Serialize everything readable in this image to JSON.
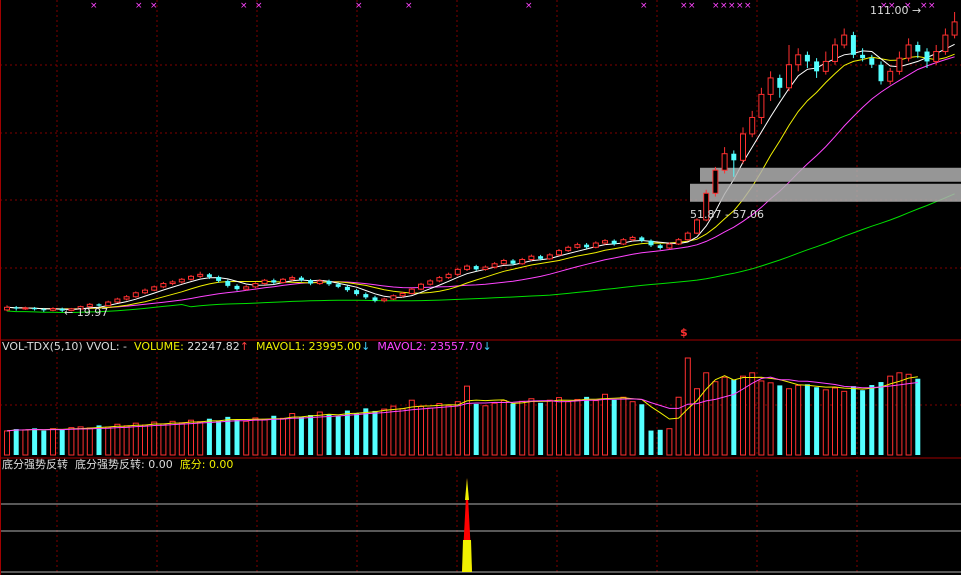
{
  "main_chart": {
    "high_label": "111.00",
    "low_label": "19.97",
    "range_label": "51.87 - 57.06",
    "signal_marker": "$"
  },
  "volume_panel": {
    "name": "VOL-TDX(5,10)",
    "vvol": "VVOL: -",
    "volume_label": "VOLUME:",
    "volume_value": "22247.82",
    "volume_arrow": "↑",
    "mavol1_label": "MAVOL1:",
    "mavol1_value": "23995.00",
    "mavol1_arrow": "↓",
    "mavol2_label": "MAVOL2:",
    "mavol2_value": "23557.70",
    "mavol2_arrow": "↓"
  },
  "indicator_panel": {
    "name": "底分强势反转",
    "signal_label": "底分强势反转:",
    "signal_value": "0.00",
    "dif_label": "底分:",
    "dif_value": "0.00"
  },
  "colors": {
    "background": "#000000",
    "up": "#ff3030",
    "down": "#54ffff",
    "ma_fast": "#ffffff",
    "ma_yellow": "#f0f000",
    "ma_magenta": "#ff44ff",
    "ma_green": "#00e000",
    "grid": "#800000"
  },
  "chart_data": {
    "type": "candlestick",
    "price_range": [
      19.97,
      111.0
    ],
    "candles": [
      [
        20.6,
        21.4,
        22.0,
        20.2
      ],
      [
        21.4,
        21.0,
        21.8,
        20.4
      ],
      [
        21.0,
        21.2,
        21.6,
        20.6
      ],
      [
        21.2,
        20.8,
        21.5,
        20.4
      ],
      [
        20.8,
        20.5,
        21.2,
        20.0
      ],
      [
        20.5,
        21.0,
        21.4,
        20.2
      ],
      [
        21.0,
        20.4,
        21.3,
        19.97
      ],
      [
        20.4,
        20.9,
        21.2,
        20.2
      ],
      [
        20.9,
        21.6,
        21.9,
        20.7
      ],
      [
        21.6,
        22.3,
        22.7,
        21.3
      ],
      [
        22.3,
        21.9,
        22.6,
        21.6
      ],
      [
        21.9,
        23.0,
        23.4,
        21.7
      ],
      [
        23.0,
        23.9,
        24.3,
        22.7
      ],
      [
        23.9,
        24.6,
        25.1,
        23.5
      ],
      [
        24.6,
        25.8,
        26.2,
        24.3
      ],
      [
        25.8,
        26.6,
        27.1,
        25.4
      ],
      [
        26.6,
        27.6,
        28.0,
        26.3
      ],
      [
        27.6,
        28.6,
        29.1,
        27.2
      ],
      [
        28.6,
        29.1,
        29.6,
        28.1
      ],
      [
        29.1,
        29.9,
        30.3,
        28.6
      ],
      [
        29.9,
        30.8,
        31.2,
        29.5
      ],
      [
        30.8,
        31.4,
        32.2,
        30.3
      ],
      [
        31.4,
        30.6,
        31.8,
        30.0
      ],
      [
        30.6,
        29.4,
        31.0,
        28.9
      ],
      [
        29.4,
        27.9,
        29.8,
        27.4
      ],
      [
        27.9,
        26.9,
        28.4,
        26.4
      ],
      [
        26.9,
        27.6,
        28.1,
        26.5
      ],
      [
        27.6,
        28.6,
        29.0,
        27.2
      ],
      [
        28.6,
        29.6,
        30.0,
        28.2
      ],
      [
        29.6,
        28.9,
        30.1,
        28.4
      ],
      [
        28.9,
        29.9,
        30.3,
        28.6
      ],
      [
        29.9,
        30.4,
        31.0,
        29.4
      ],
      [
        30.4,
        29.6,
        30.9,
        29.2
      ],
      [
        29.6,
        28.6,
        30.0,
        28.1
      ],
      [
        28.6,
        29.4,
        29.9,
        28.2
      ],
      [
        29.4,
        28.4,
        29.8,
        27.9
      ],
      [
        28.4,
        27.6,
        28.9,
        27.2
      ],
      [
        27.6,
        26.6,
        28.0,
        26.1
      ],
      [
        26.6,
        25.4,
        27.0,
        24.9
      ],
      [
        25.4,
        24.4,
        25.9,
        23.9
      ],
      [
        24.4,
        23.4,
        24.9,
        22.9
      ],
      [
        23.4,
        23.9,
        24.3,
        22.9
      ],
      [
        23.9,
        24.9,
        25.3,
        23.6
      ],
      [
        24.9,
        25.6,
        26.1,
        24.4
      ],
      [
        25.6,
        26.9,
        27.3,
        25.3
      ],
      [
        26.9,
        28.4,
        28.8,
        26.6
      ],
      [
        28.4,
        29.4,
        29.9,
        28.0
      ],
      [
        29.4,
        30.4,
        30.9,
        29.0
      ],
      [
        30.4,
        31.4,
        31.9,
        30.0
      ],
      [
        31.4,
        32.9,
        33.4,
        31.0
      ],
      [
        32.9,
        33.9,
        34.4,
        32.4
      ],
      [
        33.9,
        32.9,
        34.3,
        32.4
      ],
      [
        32.9,
        33.6,
        34.1,
        32.5
      ],
      [
        33.6,
        34.6,
        35.1,
        33.2
      ],
      [
        34.6,
        35.6,
        36.1,
        34.2
      ],
      [
        35.6,
        34.6,
        36.0,
        34.1
      ],
      [
        34.6,
        35.9,
        36.4,
        34.3
      ],
      [
        35.9,
        36.9,
        37.4,
        35.5
      ],
      [
        36.9,
        36.1,
        37.3,
        35.6
      ],
      [
        36.1,
        37.3,
        37.8,
        35.8
      ],
      [
        37.3,
        38.6,
        39.1,
        37.0
      ],
      [
        38.6,
        39.6,
        40.1,
        38.2
      ],
      [
        39.6,
        40.4,
        41.0,
        39.2
      ],
      [
        40.4,
        39.6,
        40.9,
        39.1
      ],
      [
        39.6,
        40.9,
        41.4,
        39.3
      ],
      [
        40.9,
        41.6,
        42.1,
        40.4
      ],
      [
        41.6,
        40.6,
        42.0,
        40.1
      ],
      [
        40.6,
        41.9,
        42.4,
        40.3
      ],
      [
        41.9,
        42.6,
        43.1,
        41.5
      ],
      [
        42.6,
        41.6,
        43.0,
        41.1
      ],
      [
        41.6,
        40.2,
        42.0,
        39.7
      ],
      [
        40.2,
        39.4,
        40.6,
        38.9
      ],
      [
        39.4,
        40.6,
        41.1,
        39.0
      ],
      [
        40.6,
        41.9,
        42.4,
        40.3
      ],
      [
        41.9,
        43.9,
        44.4,
        41.6
      ],
      [
        43.9,
        47.9,
        48.4,
        43.6
      ],
      [
        47.9,
        56.0,
        57.06,
        47.5
      ],
      [
        56.0,
        63.0,
        64.0,
        55.0
      ],
      [
        63.0,
        68.0,
        70.0,
        62.0
      ],
      [
        68.0,
        66.0,
        69.0,
        61.0
      ],
      [
        66.0,
        74.0,
        76.0,
        65.0
      ],
      [
        74.0,
        79.0,
        81.0,
        73.0
      ],
      [
        79.0,
        86.0,
        88.0,
        77.0
      ],
      [
        86.0,
        91.0,
        93.0,
        84.0
      ],
      [
        91.0,
        88.0,
        92.0,
        85.0
      ],
      [
        88.0,
        95.0,
        101.0,
        87.0
      ],
      [
        95.0,
        98.0,
        100.0,
        93.0
      ],
      [
        98.0,
        96.0,
        99.0,
        94.0
      ],
      [
        96.0,
        93.0,
        97.0,
        91.0
      ],
      [
        93.0,
        96.0,
        99.0,
        92.0
      ],
      [
        96.0,
        101.0,
        103.0,
        95.0
      ],
      [
        101.0,
        104.0,
        106.0,
        100.0
      ],
      [
        104.0,
        98.0,
        105.0,
        97.0
      ],
      [
        98.0,
        97.0,
        100.0,
        96.0
      ],
      [
        97.0,
        95.0,
        98.0,
        94.0
      ],
      [
        95.0,
        90.0,
        96.0,
        89.0
      ],
      [
        90.0,
        93.0,
        94.0,
        89.0
      ],
      [
        93.0,
        97.0,
        99.0,
        92.0
      ],
      [
        97.0,
        101.0,
        103.0,
        96.0
      ],
      [
        101.0,
        99.0,
        102.0,
        97.0
      ],
      [
        99.0,
        96.0,
        100.0,
        94.0
      ],
      [
        96.0,
        99.0,
        101.0,
        95.0
      ],
      [
        99.0,
        104.0,
        106.0,
        98.0
      ],
      [
        104.0,
        108.0,
        111.0,
        103.0
      ]
    ],
    "volume": [
      6.5,
      7.0,
      6.8,
      7.2,
      6.6,
      7.1,
      6.9,
      7.4,
      7.6,
      7.3,
      8.0,
      7.5,
      8.3,
      7.9,
      8.6,
      8.1,
      8.9,
      8.4,
      9.1,
      8.7,
      9.4,
      9.0,
      9.8,
      9.2,
      10.3,
      9.6,
      9.1,
      10.0,
      9.5,
      10.6,
      9.9,
      11.2,
      10.3,
      10.8,
      11.6,
      11.0,
      10.5,
      12.0,
      11.3,
      12.6,
      11.9,
      12.4,
      13.2,
      12.5,
      14.8,
      13.1,
      12.7,
      13.9,
      13.4,
      14.4,
      18.6,
      13.8,
      13.3,
      14.0,
      14.7,
      13.9,
      14.5,
      15.2,
      14.1,
      14.8,
      15.5,
      14.4,
      15.0,
      15.7,
      14.7,
      16.4,
      14.9,
      15.6,
      14.4,
      13.7,
      6.6,
      6.8,
      7.1,
      15.6,
      26.2,
      17.9,
      22.2,
      19.8,
      21.0,
      20.4,
      21.3,
      22.2,
      20.0,
      19.5,
      18.8,
      17.9,
      18.8,
      19.1,
      18.3,
      17.6,
      18.1,
      17.2,
      18.6,
      17.5,
      18.9,
      19.7,
      21.3,
      22.2,
      21.8,
      20.6
    ],
    "volume_range": [
      0,
      26.2
    ],
    "indicator": {
      "type": "bar",
      "spike_index": 50,
      "range": [
        0,
        1
      ]
    }
  }
}
